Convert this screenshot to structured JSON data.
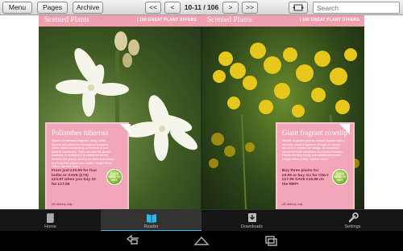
{
  "toolbar": {
    "menu_label": "Menu",
    "pages_label": "Pages",
    "archive_label": "Archive",
    "first_label": "<<",
    "prev_label": "<",
    "page_indicator": "10-11 / 106",
    "next_label": ">",
    "last_label": ">>",
    "search_placeholder": "Search"
  },
  "left_page": {
    "header_title": "Scented Plants",
    "header_offer": "| 100 GREAT PLANT OFFERS",
    "card": {
      "title": "Polianthes tuberosa",
      "description": "Spikes of intensely fragrant, waxy, white flowers are produced throughout summer, which make enchanting cut flowers or just plant in containers. They can also be grown outdoors in containers or sheltered sunny borders but plants need to be lifted and stored in a frost-free place over winter. Height 90cm (36in). Spread 15cm.",
      "price": "From just £10.99 for four bulbs or SAVE (£?5) £23.97 when you buy 10 for £17.99",
      "delivery": "UK delivery only",
      "button": "CLICK HERE TO BUY"
    }
  },
  "right_page": {
    "header_title": "Scented Plants",
    "header_offer": "| 100 GREAT PLANT OFFERS",
    "card": {
      "title": "Giant fragrant cowslip",
      "description": "Whorls of golden yellow, tubular flowers with a delicate, sweet fragrance sit high on stems above the rosettes of foliage. An excellent choice for both woodland and sunny borders. Plants are fully hardy and reliably perennial. Height 45cm (18in). Spread 30cm.",
      "price": "Buy three plants for £9.99 or buy six for ONLY £17.99 SAVE £19.98 on the RRP!",
      "delivery": "UK delivery only",
      "button": "CLICK HERE TO BUY"
    }
  },
  "nav": {
    "home": "Home",
    "reader": "Reader",
    "downloads": "Downloads",
    "settings": "Settings"
  }
}
